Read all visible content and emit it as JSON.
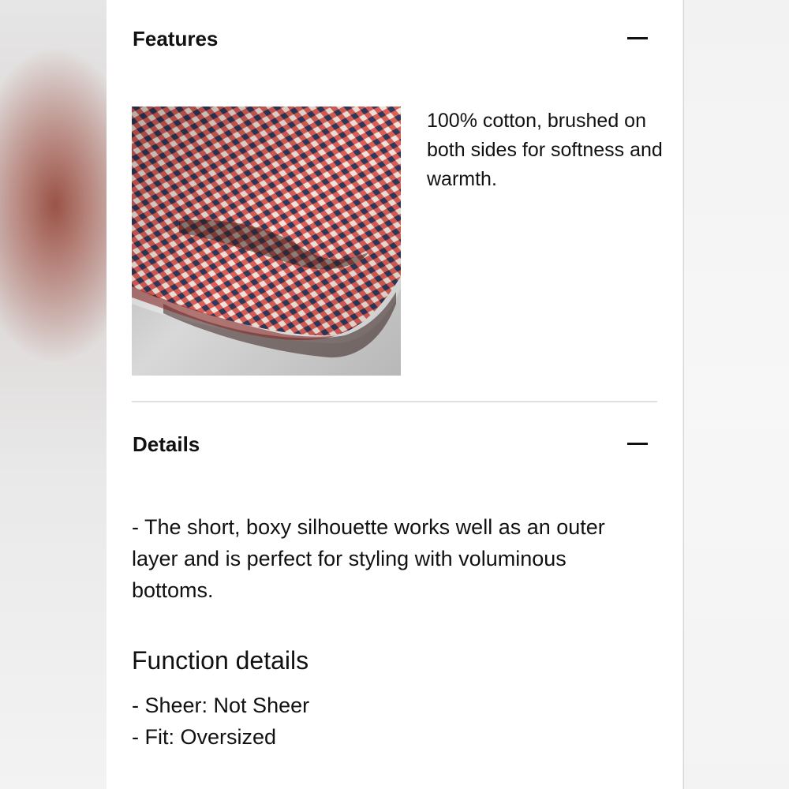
{
  "features": {
    "title": "Features",
    "toggle_icon": "minus-icon",
    "image_subject": "red and navy gingham check fabric",
    "description": "100% cotton, brushed on both sides for softness and warmth."
  },
  "details": {
    "title": "Details",
    "toggle_icon": "minus-icon",
    "description": "- The short, boxy silhouette works well as an outer layer and is perfect for styling with voluminous bottoms.",
    "function_title": "Function details",
    "function_items": [
      "- Sheer: Not Sheer",
      "- Fit: Oversized"
    ]
  },
  "colors": {
    "fabric_red": "#d9463f",
    "fabric_navy": "#2d3a5c",
    "fabric_cream": "#f2e6dc"
  }
}
